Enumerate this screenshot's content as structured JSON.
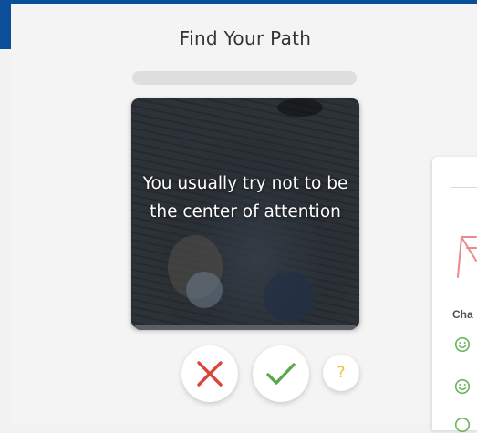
{
  "header": {
    "title": "Find Your Path"
  },
  "quiz": {
    "progress_percent": 0,
    "statement": "You usually try not to be the center of attention",
    "buttons": {
      "no_icon": "close-icon",
      "yes_icon": "check-icon",
      "help_label": "?"
    }
  },
  "side_panel": {
    "heading": "Cha"
  },
  "colors": {
    "brand_blue": "#0b4f9a",
    "no_red": "#d9453a",
    "yes_green": "#5aa84a",
    "help_yellow": "#e8c43b",
    "smile_green": "#6cb35a",
    "art_pink": "#e88a8a"
  }
}
